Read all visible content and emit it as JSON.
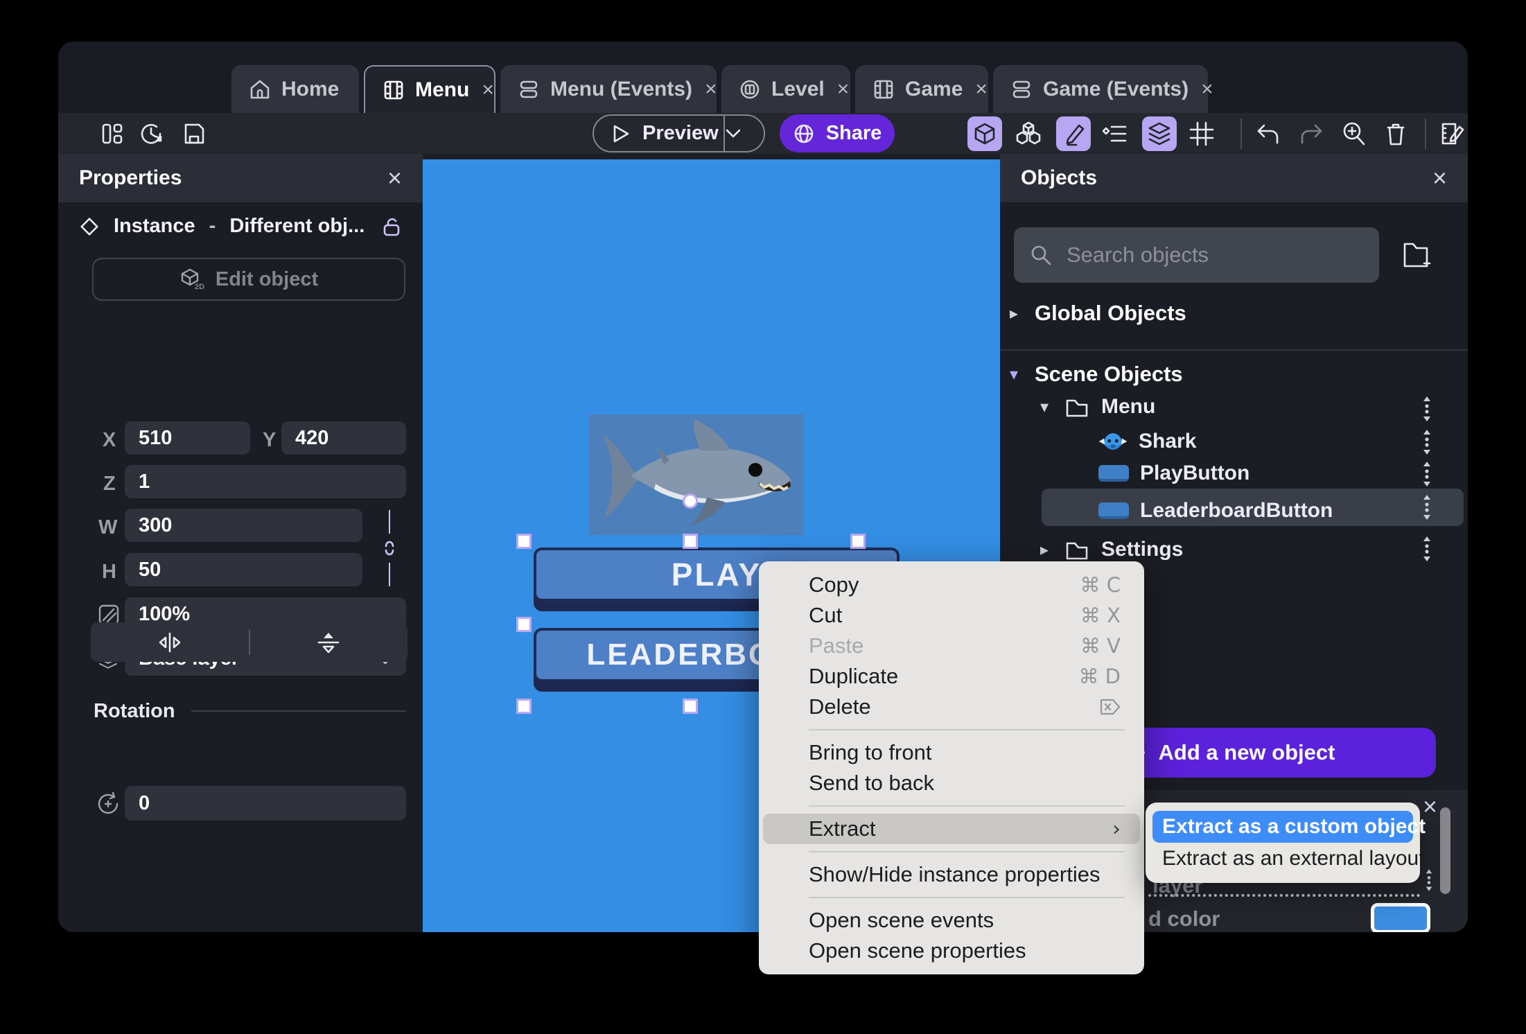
{
  "tabs": {
    "home": "Home",
    "menu": "Menu",
    "menu_events": "Menu (Events)",
    "level": "Level",
    "game": "Game",
    "game_events": "Game (Events)",
    "close_glyph": "×"
  },
  "toolbar": {
    "preview": "Preview",
    "share": "Share"
  },
  "properties": {
    "title": "Properties",
    "close_glyph": "×",
    "instance_kind": "Instance",
    "instance_dash": "-",
    "instance_object": "Different obj...",
    "edit_object": "Edit object",
    "edit_object_badge": "2D",
    "x_label": "X",
    "x": "510",
    "y_label": "Y",
    "y": "420",
    "z_label": "Z",
    "z": "1",
    "w_label": "W",
    "w": "300",
    "h_label": "H",
    "h": "50",
    "opacity": "100%",
    "layer": "Base layer",
    "layer_caret": "⌄",
    "rotation_title": "Rotation",
    "rotation": "0"
  },
  "canvas": {
    "play": "PLAY",
    "leaderboard": "LEADERBOARD"
  },
  "objects": {
    "title": "Objects",
    "close_glyph": "×",
    "search_placeholder": "Search objects",
    "global_label": "Global Objects",
    "scene_label": "Scene Objects",
    "chevron_down": "▾",
    "chevron_right": "▸",
    "tree": {
      "menu": "Menu",
      "shark": "Shark",
      "play_button": "PlayButton",
      "leaderboard_button": "LeaderboardButton",
      "settings": "Settings"
    },
    "add_button": "Add a new object"
  },
  "bottom_panel": {
    "close_glyph": "×",
    "layer_fragment": "layer",
    "color_fragment": "d color",
    "swatch_color": "#3d8ee2"
  },
  "context_menu": {
    "copy": "Copy",
    "copy_sc": "⌘ C",
    "cut": "Cut",
    "cut_sc": "⌘ X",
    "paste": "Paste",
    "paste_sc": "⌘ V",
    "duplicate": "Duplicate",
    "duplicate_sc": "⌘ D",
    "delete": "Delete",
    "bring_front": "Bring to front",
    "send_back": "Send to back",
    "extract": "Extract",
    "extract_chevron": "›",
    "show_hide": "Show/Hide instance properties",
    "open_events": "Open scene events",
    "open_props": "Open scene properties"
  },
  "submenu": {
    "custom_object": "Extract as a custom object",
    "external_layout": "Extract as an external layout"
  },
  "colors": {
    "accent_purple": "#6526d9",
    "add_button_purple": "#5c21da",
    "active_tool_bg": "#b7a6f2",
    "canvas_blue": "#348ee4",
    "game_button_blue": "#4d80c6",
    "submenu_selection_blue": "#3e8cf7",
    "traffic_red": "#ff5f57",
    "traffic_yellow": "#febc2e",
    "traffic_green": "#29c73f"
  }
}
